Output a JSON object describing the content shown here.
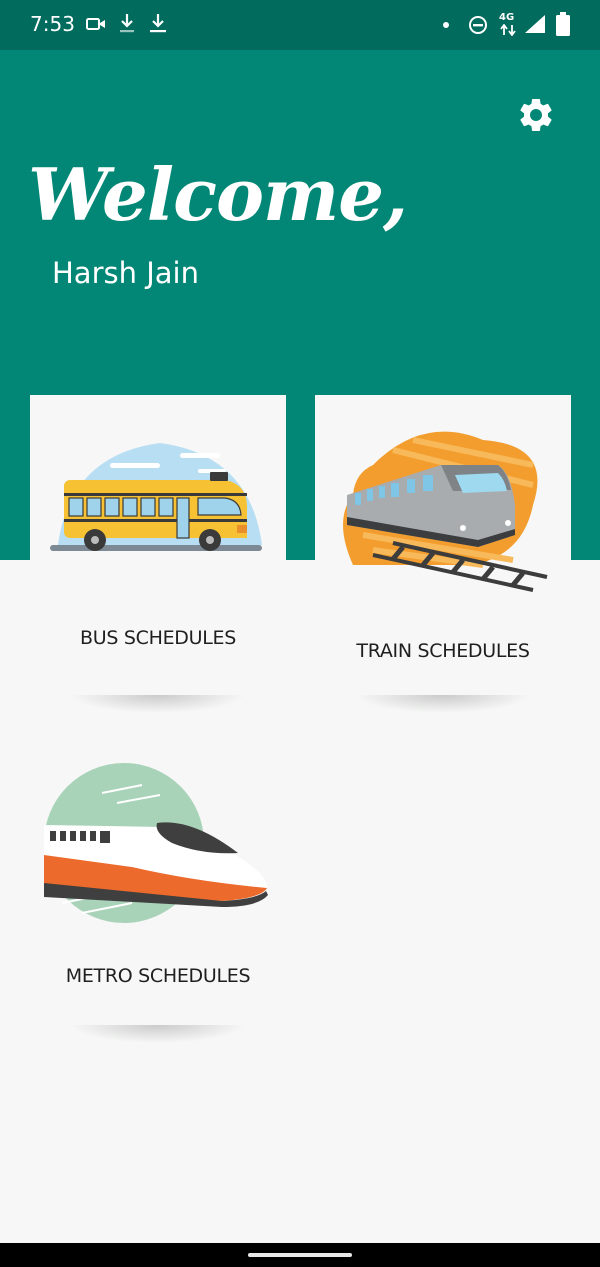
{
  "status_bar": {
    "time": "7:53",
    "network": "4G",
    "icons": [
      "video-camera-icon",
      "download-icon",
      "download-icon",
      "notification-dot-icon",
      "do-not-disturb-icon",
      "network-4g-icon",
      "signal-icon",
      "battery-icon"
    ]
  },
  "header": {
    "greeting": "Welcome,",
    "user_name": "Harsh Jain",
    "settings_icon": "gear-icon",
    "background_color": "#028776"
  },
  "cards": [
    {
      "label": "BUS SCHEDULES",
      "icon": "bus-illustration"
    },
    {
      "label": "TRAIN SCHEDULES",
      "icon": "train-illustration"
    },
    {
      "label": "METRO SCHEDULES",
      "icon": "metro-illustration"
    }
  ],
  "colors": {
    "status_bar": "#016b5d",
    "accent": "#028776",
    "background": "#f6f7f6"
  }
}
